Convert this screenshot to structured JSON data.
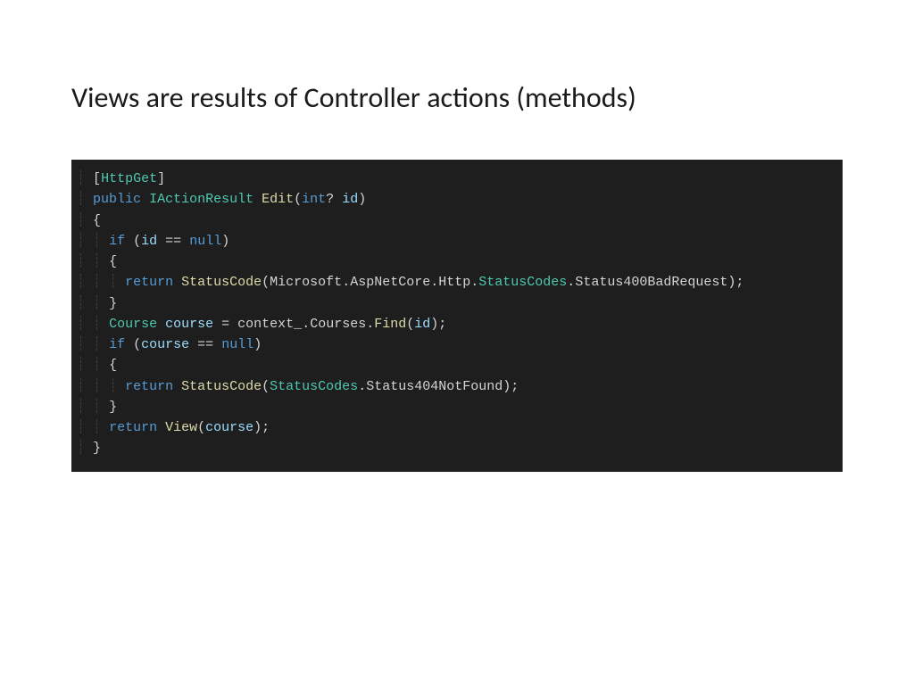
{
  "slide": {
    "title": "Views are results of Controller actions (methods)"
  },
  "code": {
    "tokens": {
      "attr_httpget": "HttpGet",
      "kw_public": "public",
      "type_iactionresult": "IActionResult",
      "method_edit": "Edit",
      "kw_int": "int",
      "param_id": "id",
      "kw_if": "if",
      "kw_null": "null",
      "kw_return": "return",
      "method_statuscode": "StatusCode",
      "ns_microsoft": "Microsoft",
      "ns_aspnetcore": "AspNetCore",
      "ns_http": "Http",
      "type_statuscodes": "StatusCodes",
      "prop_400": "Status400BadRequest",
      "type_course": "Course",
      "var_course": "course",
      "field_context": "context_",
      "prop_courses": "Courses",
      "method_find": "Find",
      "prop_404": "Status404NotFound",
      "method_view": "View"
    }
  }
}
